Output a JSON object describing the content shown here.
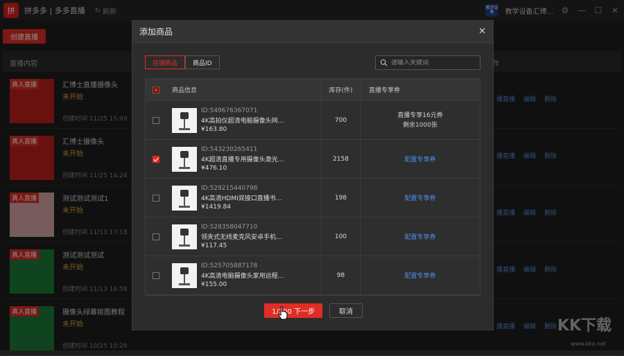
{
  "titlebar": {
    "logo_text": "拼",
    "app_title": "拼多多 | 多多直播",
    "refresh_label": "刷新",
    "badge_text": "教学设备",
    "account_name": "教学设备汇博..."
  },
  "page": {
    "create_live_label": "创建直播",
    "list_header_left": "直播内容",
    "list_header_right": "作"
  },
  "live_rows": [
    {
      "tag": "真人直播",
      "title": "汇博士直播摄像头",
      "status": "未开始",
      "time": "创建时间 11/25 15:09",
      "thumb_color": "#c0201c",
      "actions": [
        "播直播",
        "编辑",
        "删除"
      ]
    },
    {
      "tag": "真人直播",
      "title": "汇博士摄像头",
      "status": "未开始",
      "time": "创建时间 11/25 14:24",
      "thumb_color": "#c0201c",
      "actions": [
        "播直播",
        "编辑",
        "删除"
      ]
    },
    {
      "tag": "真人直播",
      "title": "测试测试测试1",
      "status": "未开始",
      "time": "创建时间 11/13 17:18",
      "thumb_color": "#d8a8a8",
      "actions": [
        "播直播",
        "编辑",
        "删除"
      ]
    },
    {
      "tag": "真人直播",
      "title": "测试测试测试",
      "status": "未开始",
      "time": "创建时间 11/13 16:58",
      "thumb_color": "#1e7a3a",
      "actions": [
        "播直播",
        "编辑",
        "删除"
      ]
    },
    {
      "tag": "真人直播",
      "title": "摄像头绿幕抠图教程",
      "status": "未开始",
      "time": "创建时间 10/25 10:26",
      "thumb_color": "#1e7a3a",
      "actions": [
        "播直播",
        "编辑",
        "删除"
      ]
    }
  ],
  "dialog": {
    "title": "添加商品",
    "tabs": [
      {
        "label": "店铺商品",
        "active": true
      },
      {
        "label": "商品ID",
        "active": false
      }
    ],
    "search_placeholder": "请输入关键词",
    "columns": {
      "info": "商品信息",
      "stock": "库存(件)",
      "coupon": "直播专享券"
    },
    "products": [
      {
        "checked": false,
        "id": "ID:549676367071",
        "name": "4K高拍仪超清电脑摄像头网...",
        "price": "¥163.80",
        "stock": "700",
        "coupon_lines": [
          "直播专享16元券",
          "剩余1000张"
        ],
        "coupon_link": ""
      },
      {
        "checked": true,
        "id": "ID:543230265411",
        "name": "4K超清直播专用摄像头激光...",
        "price": "¥476.10",
        "stock": "2158",
        "coupon_lines": [],
        "coupon_link": "配置专享券"
      },
      {
        "checked": false,
        "id": "ID:529215440798",
        "name": "4K高清HDMI双接口直播书...",
        "price": "¥1419.84",
        "stock": "198",
        "coupon_lines": [],
        "coupon_link": "配置专享券"
      },
      {
        "checked": false,
        "id": "ID:528358047710",
        "name": "领夹式无线麦克风安卓手机...",
        "price": "¥117.45",
        "stock": "100",
        "coupon_lines": [],
        "coupon_link": "配置专享券"
      },
      {
        "checked": false,
        "id": "ID:525705887178",
        "name": "4K高清电脑摄像头家用远程...",
        "price": "¥155.00",
        "stock": "98",
        "coupon_lines": [],
        "coupon_link": "配置专享券"
      }
    ],
    "next_label": "1/200 下一步",
    "cancel_label": "取消"
  },
  "watermark": {
    "text": "KK下载",
    "url": "www.kkx.net"
  },
  "colors": {
    "accent": "#e02e24",
    "link": "#4a8ff0",
    "status": "#e6a23c"
  }
}
